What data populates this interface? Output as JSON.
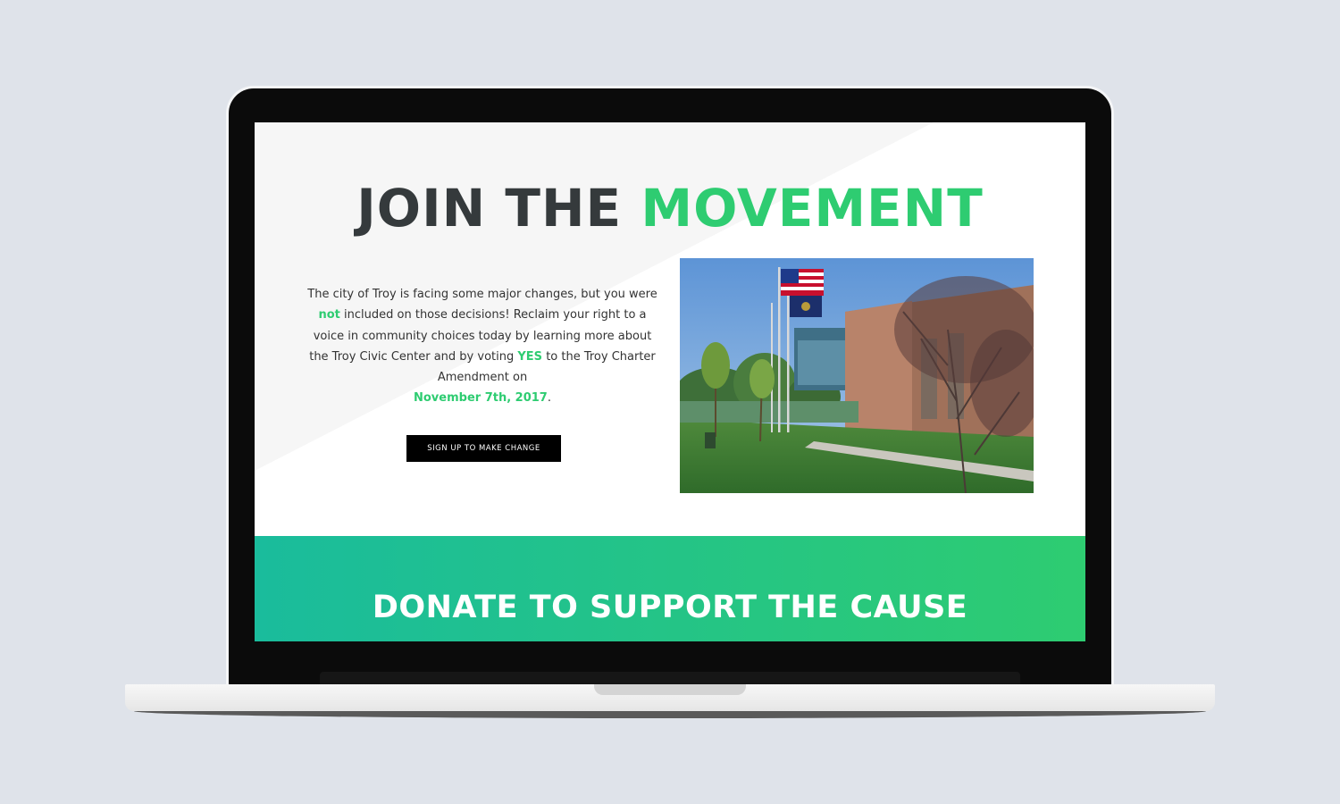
{
  "hero": {
    "title_part1": "JOIN THE",
    "title_part2": "MOVEMENT",
    "intro": {
      "p1": "The city of Troy is facing some major changes, but you were",
      "not": "not",
      "p2": "included on those decisions! Reclaim your right to a voice in community choices today by learning more about the Troy Civic Center and by voting",
      "yes": "YES",
      "p3": "to the Troy Charter Amendment on",
      "date": "November 7th, 2017",
      "end": "."
    },
    "cta_label": "SIGN UP TO MAKE CHANGE"
  },
  "donate": {
    "title": "DONATE TO SUPPORT THE CAUSE"
  },
  "colors": {
    "accent": "#2ecc71",
    "accent_teal": "#1abc9c",
    "heading": "#353a3c",
    "cta_bg": "#000000"
  }
}
